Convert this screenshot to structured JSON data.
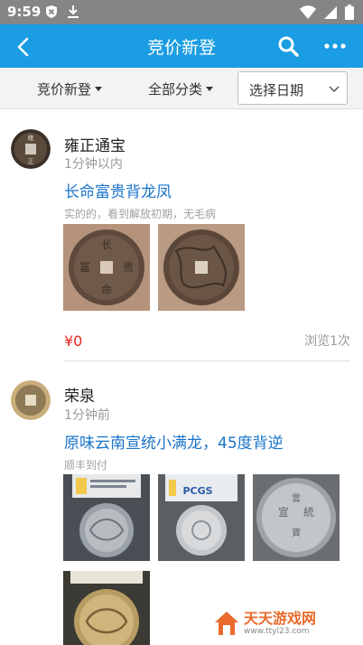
{
  "status_bar": {
    "time": "9:59",
    "icons_left": [
      "shield-x-icon",
      "download-icon"
    ],
    "icons_right": [
      "wifi-icon",
      "signal-icon",
      "battery-icon"
    ]
  },
  "app_bar": {
    "title": "竞价新登",
    "color": "#1a9de3",
    "icons": [
      "back-arrow-icon",
      "search-icon",
      "more-icon"
    ]
  },
  "filters": {
    "sort_label": "竞价新登",
    "category_label": "全部分类",
    "date_placeholder": "选择日期"
  },
  "posts": [
    {
      "user": "雍正通宝",
      "time": "1分钟以内",
      "title": "长命富贵背龙凤",
      "description": "实的的，看到解放初期，无毛病",
      "price": "¥0",
      "views": "浏览1次"
    },
    {
      "user": "荣泉",
      "time": "1分钟前",
      "title": "原味云南宣统小满龙，45度背逆",
      "description": "顺丰到付"
    }
  ],
  "watermark": {
    "name": "天天游戏网",
    "url": "www.ttyl23.com"
  },
  "colors": {
    "accent": "#1a9de3",
    "price": "#e8291e",
    "title_link": "#1a73c9"
  }
}
